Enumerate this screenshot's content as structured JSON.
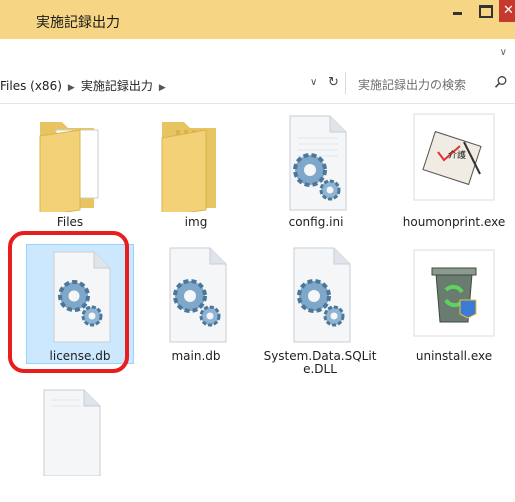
{
  "window": {
    "title": "実施記録出力"
  },
  "address": {
    "segments": [
      "Files (x86)",
      "実施記録出力"
    ],
    "dropdown_glyph": "∨",
    "refresh_glyph": "↻"
  },
  "search": {
    "placeholder": "実施記録出力の検索"
  },
  "files": [
    {
      "name": "Files",
      "icon": "folder-icon",
      "selected": false
    },
    {
      "name": "img",
      "icon": "folder-icon",
      "selected": false
    },
    {
      "name": "config.ini",
      "icon": "settings-file-icon",
      "selected": false
    },
    {
      "name": "houmonprint.exe",
      "icon": "app-exe-icon",
      "selected": false
    },
    {
      "name": "license.db",
      "icon": "settings-file-icon",
      "selected": true
    },
    {
      "name": "main.db",
      "icon": "settings-file-icon",
      "selected": false
    },
    {
      "name": "System.Data.SQLite.DLL",
      "icon": "settings-file-icon",
      "selected": false
    },
    {
      "name": "uninstall.exe",
      "icon": "recycle-exe-icon",
      "selected": false
    },
    {
      "name": "",
      "icon": "blank-file-icon",
      "selected": false
    }
  ],
  "colors": {
    "titlebar": "#f6d684",
    "selection": "#cce8ff",
    "highlight": "#e81d1d",
    "close": "#c7392e"
  }
}
